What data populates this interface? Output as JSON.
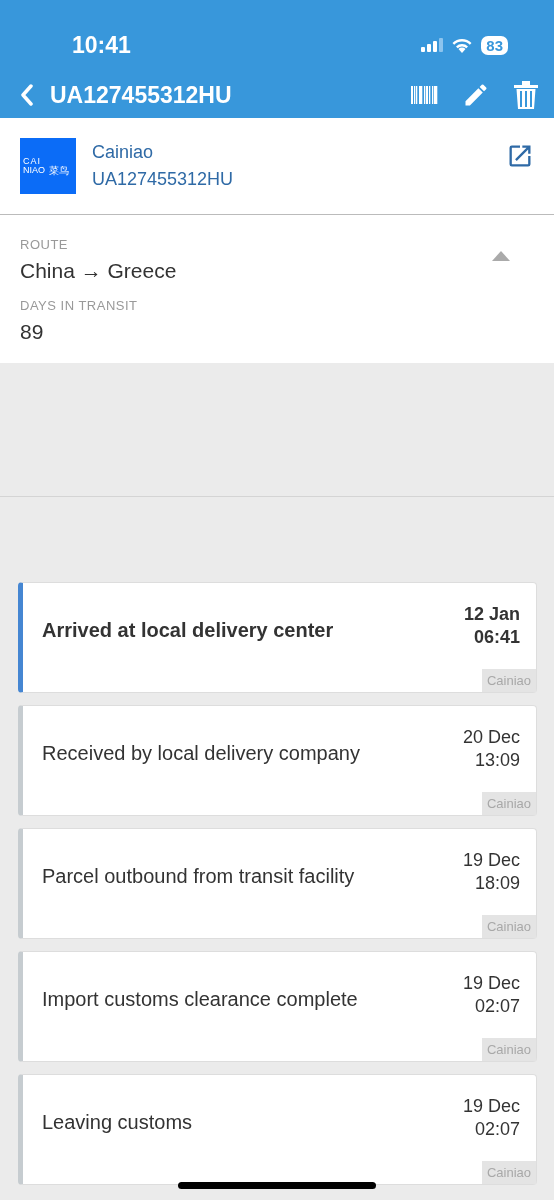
{
  "status_bar": {
    "time": "10:41",
    "battery": "83"
  },
  "nav": {
    "title": "UA127455312HU"
  },
  "carrier": {
    "logo_lines": [
      "CAI",
      "NIAO",
      "菜鸟"
    ],
    "name": "Cainiao",
    "tracking_number": "UA127455312HU"
  },
  "details": {
    "expanded": true,
    "fields": [
      {
        "label": "ROUTE",
        "value": "China → Greece"
      },
      {
        "label": "DAYS IN TRANSIT",
        "value": "89"
      }
    ]
  },
  "events": [
    {
      "title": "Arrived at local delivery center",
      "date": "12 Jan",
      "time": "06:41",
      "source": "Cainiao",
      "latest": true
    },
    {
      "title": "Received by local  delivery company",
      "date": "20 Dec",
      "time": "13:09",
      "source": "Cainiao",
      "latest": false
    },
    {
      "title": "Parcel outbound from transit facility",
      "date": "19 Dec",
      "time": "18:09",
      "source": "Cainiao",
      "latest": false
    },
    {
      "title": "Import customs clearance complete",
      "date": "19 Dec",
      "time": "02:07",
      "source": "Cainiao",
      "latest": false
    },
    {
      "title": "Leaving customs",
      "date": "19 Dec",
      "time": "02:07",
      "source": "Cainiao",
      "latest": false
    }
  ]
}
